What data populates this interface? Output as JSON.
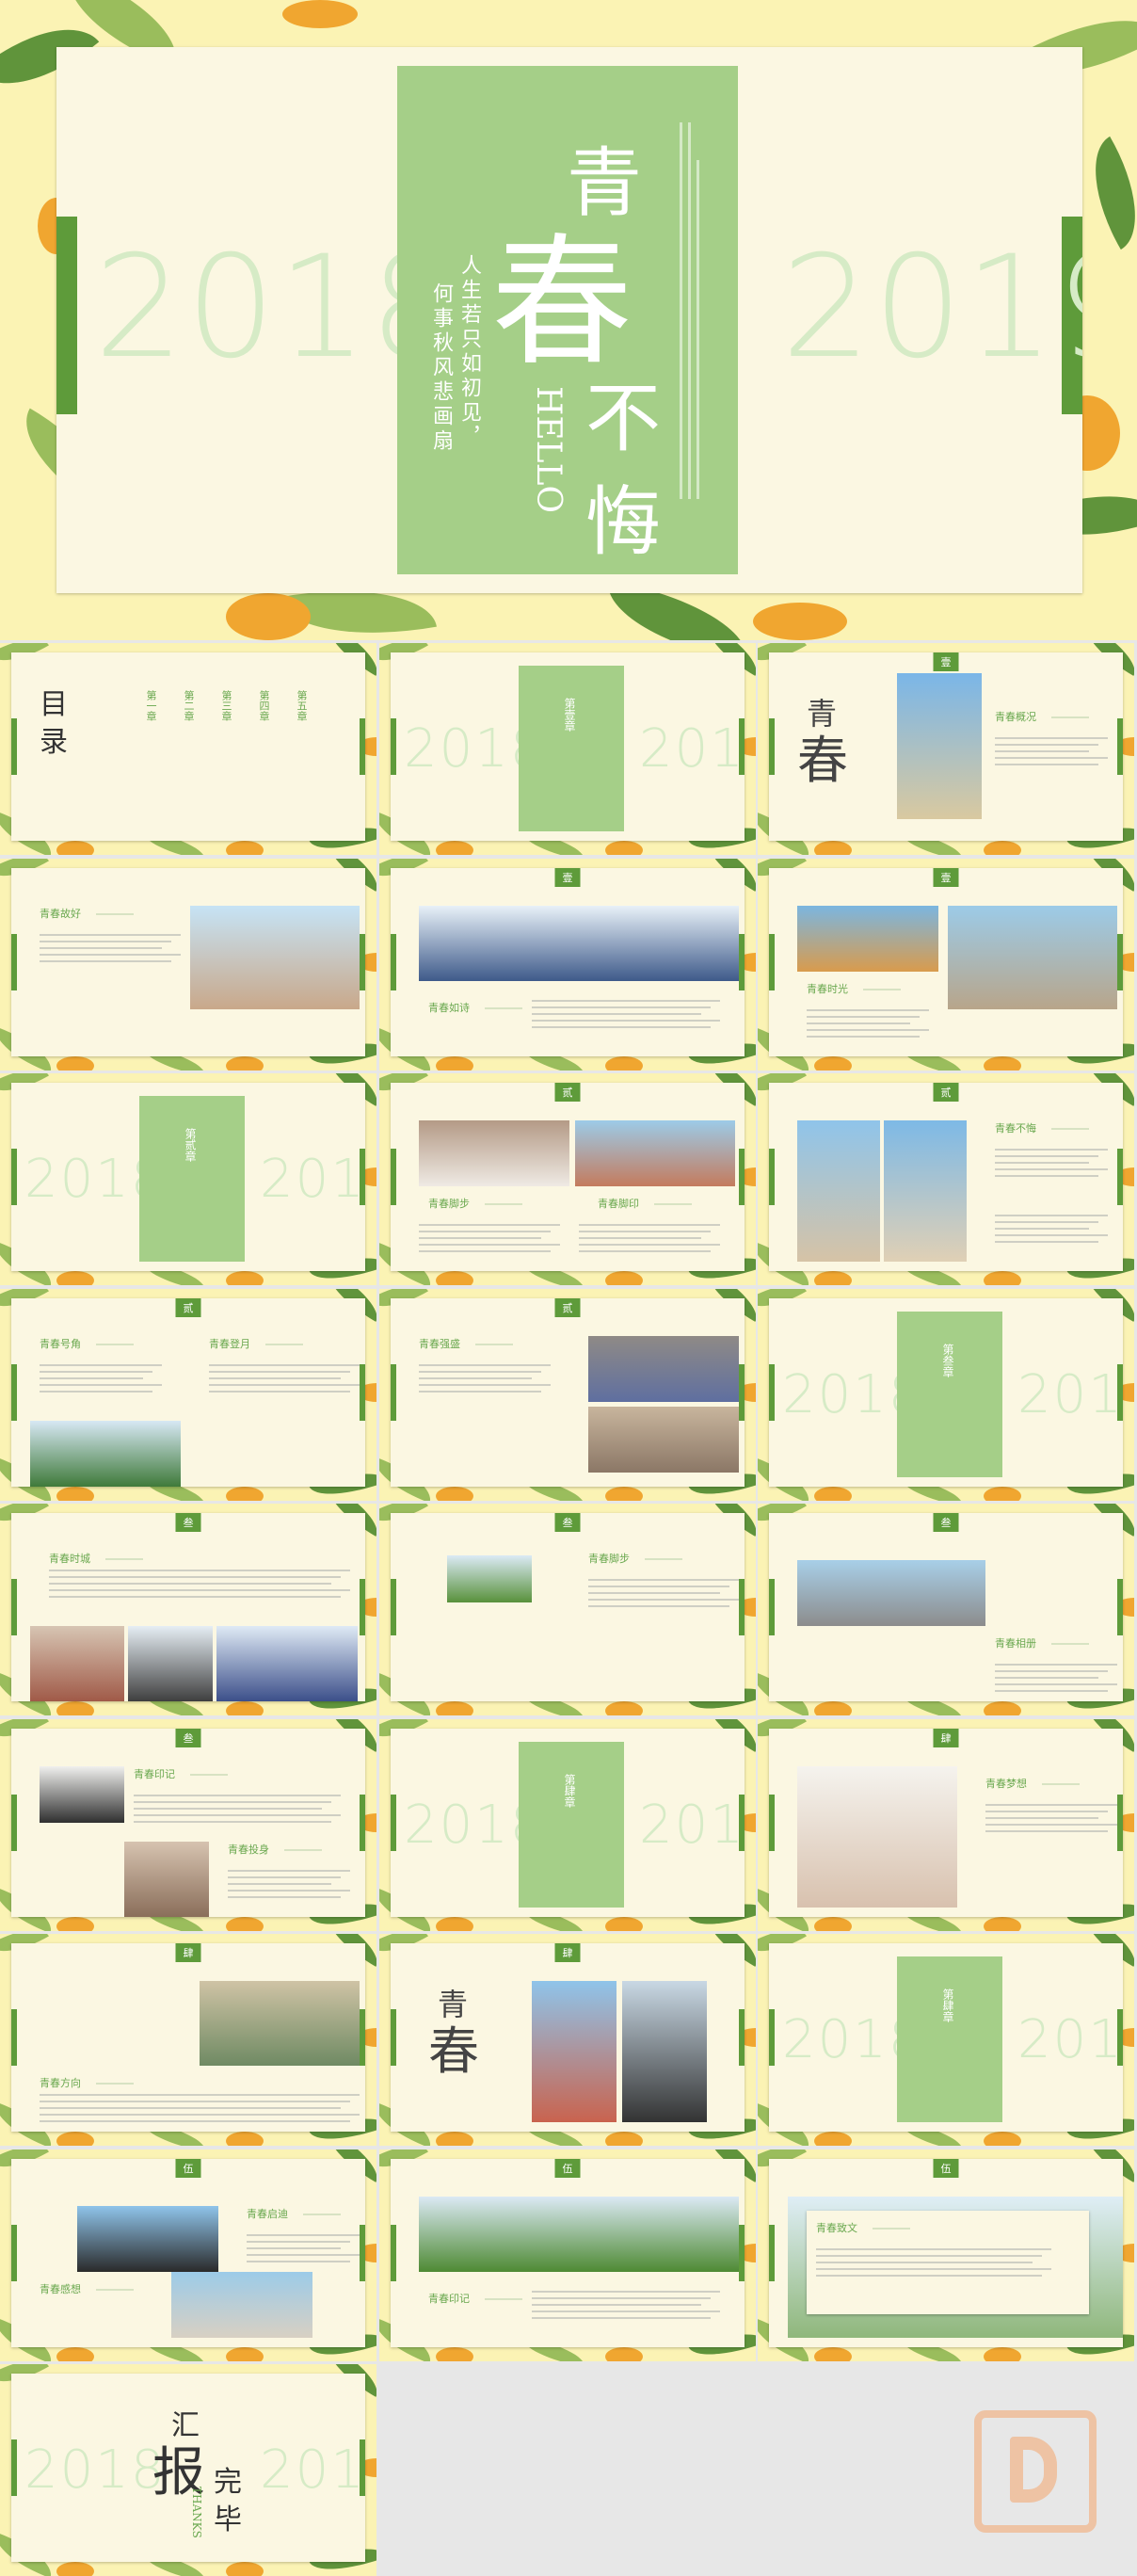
{
  "hero": {
    "char_1": "青",
    "char_2": "春",
    "char_3": "不",
    "char_4": "悔",
    "hello": "HELLO",
    "poem_line1": "人生若只如初见，",
    "poem_line2": "何事秋风悲画扇",
    "year_left": "2018",
    "year_right": "2019"
  },
  "slides": {
    "toc": {
      "title_1": "目",
      "title_2": "录",
      "items": [
        "第一章",
        "第二章",
        "第三章",
        "第四章",
        "第五章"
      ]
    },
    "chapter_titles": [
      "第壹章",
      "第贰章",
      "第叁章",
      "第肆章",
      "第伍章"
    ],
    "tags": [
      "壹",
      "贰",
      "叁",
      "肆",
      "伍"
    ],
    "section_titles": [
      "青春概况",
      "青春故好",
      "青春如诗",
      "青春时光",
      "青春脚步",
      "青春脚印",
      "青春不悔",
      "青春号角",
      "青春登月",
      "青春强盛",
      "青春时城",
      "青春脚步",
      "青春相册",
      "青春印记",
      "青春投身",
      "青春梦想",
      "青春方向",
      "青春启迪",
      "青春感想",
      "青春印记",
      "青春致文"
    ],
    "ending": {
      "c1": "汇",
      "c2": "报",
      "c3": "完",
      "c4": "毕",
      "thanks": "THANKS"
    }
  },
  "colors": {
    "accent_green": "#5e9b3a",
    "panel_green": "#a5cf88",
    "card_bg": "#fbf7e2",
    "leaf_bg": "#fbf3b4"
  },
  "watermark_icon": "p-logo-icon"
}
